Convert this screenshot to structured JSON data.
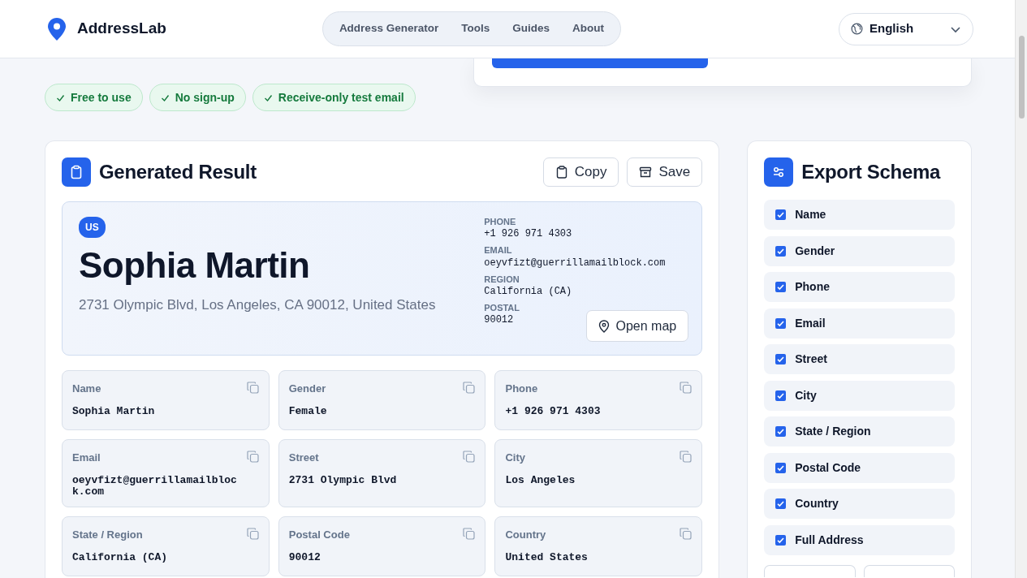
{
  "brand": "AddressLab",
  "nav": [
    {
      "label": "Address Generator"
    },
    {
      "label": "Tools"
    },
    {
      "label": "Guides"
    },
    {
      "label": "About"
    }
  ],
  "language": {
    "value": "English"
  },
  "features": [
    "Free to use",
    "No sign-up",
    "Receive-only test email"
  ],
  "result": {
    "title": "Generated Result",
    "buttons": [
      {
        "label": "Copy",
        "kind": "copy"
      },
      {
        "label": "Save",
        "kind": "save"
      }
    ],
    "hero": {
      "country": "US",
      "name": "Sophia Martin",
      "address": "2731 Olympic Blvd, Los Angeles, CA 90012, United States",
      "details": [
        {
          "label": "PHONE",
          "value": "+1 926 971 4303"
        },
        {
          "label": "EMAIL",
          "value": "oeyvfizt@guerrillamailblock.com"
        },
        {
          "label": "REGION",
          "value": "California (CA)"
        },
        {
          "label": "POSTAL",
          "value": "90012"
        }
      ],
      "map_button": "Open map"
    },
    "fields": [
      {
        "label": "Name",
        "value": "Sophia Martin"
      },
      {
        "label": "Gender",
        "value": "Female"
      },
      {
        "label": "Phone",
        "value": "+1 926 971 4303"
      },
      {
        "label": "Email",
        "value": "oeyvfizt@guerrillamailblock.com"
      },
      {
        "label": "Street",
        "value": "2731 Olympic Blvd"
      },
      {
        "label": "City",
        "value": "Los Angeles"
      },
      {
        "label": "State / Region",
        "value": "California (CA)"
      },
      {
        "label": "Postal Code",
        "value": "90012"
      },
      {
        "label": "Country",
        "value": "United States"
      }
    ]
  },
  "schema": {
    "title": "Export Schema",
    "items": [
      {
        "label": "Name",
        "checked": true
      },
      {
        "label": "Gender",
        "checked": true
      },
      {
        "label": "Phone",
        "checked": true
      },
      {
        "label": "Email",
        "checked": true
      },
      {
        "label": "Street",
        "checked": true
      },
      {
        "label": "City",
        "checked": true
      },
      {
        "label": "State / Region",
        "checked": true
      },
      {
        "label": "Postal Code",
        "checked": true
      },
      {
        "label": "Country",
        "checked": true
      },
      {
        "label": "Full Address",
        "checked": true
      }
    ]
  }
}
